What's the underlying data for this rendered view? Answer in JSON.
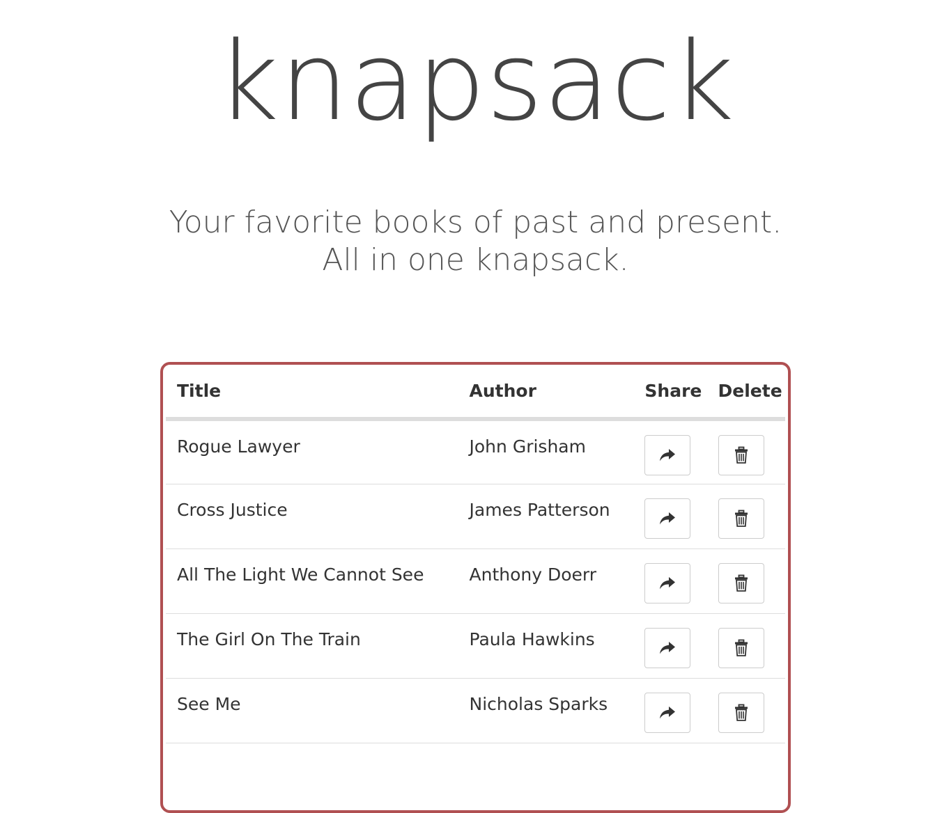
{
  "app": {
    "title": "knapsack",
    "tagline": "Your favorite books of past and present. All in one knapsack."
  },
  "colors": {
    "accent_border": "#b05052",
    "text": "#333333",
    "heading_text": "#444444"
  },
  "table": {
    "headers": {
      "title": "Title",
      "author": "Author",
      "share": "Share",
      "delete": "Delete"
    },
    "rows": [
      {
        "title": "Rogue Lawyer",
        "author": "John Grisham",
        "share_icon": "share-icon",
        "delete_icon": "trash-icon"
      },
      {
        "title": "Cross Justice",
        "author": "James Patterson",
        "share_icon": "share-icon",
        "delete_icon": "trash-icon"
      },
      {
        "title": "All The Light We Cannot See",
        "author": "Anthony Doerr",
        "share_icon": "share-icon",
        "delete_icon": "trash-icon"
      },
      {
        "title": "The Girl On The Train",
        "author": "Paula Hawkins",
        "share_icon": "share-icon",
        "delete_icon": "trash-icon"
      },
      {
        "title": "See Me",
        "author": "Nicholas Sparks",
        "share_icon": "share-icon",
        "delete_icon": "trash-icon"
      }
    ]
  }
}
